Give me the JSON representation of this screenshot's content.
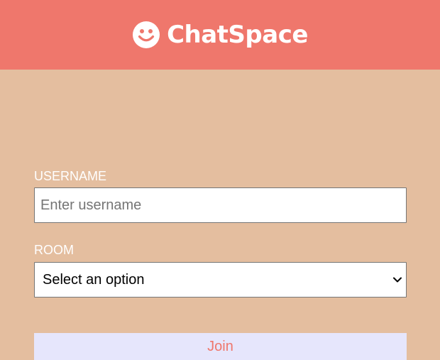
{
  "app": {
    "title": "ChatSpace",
    "logo_icon": "smiley-face-icon"
  },
  "colors": {
    "header": "#ef776c",
    "background": "#e4be9f",
    "button_bg": "#e6e6fc",
    "button_text": "#ef776c"
  },
  "form": {
    "username_label": "USERNAME",
    "username_placeholder": "Enter username",
    "username_value": "",
    "room_label": "ROOM",
    "room_selected": "Select an option",
    "room_icon": "chevron-down-icon",
    "join_label": "Join"
  }
}
